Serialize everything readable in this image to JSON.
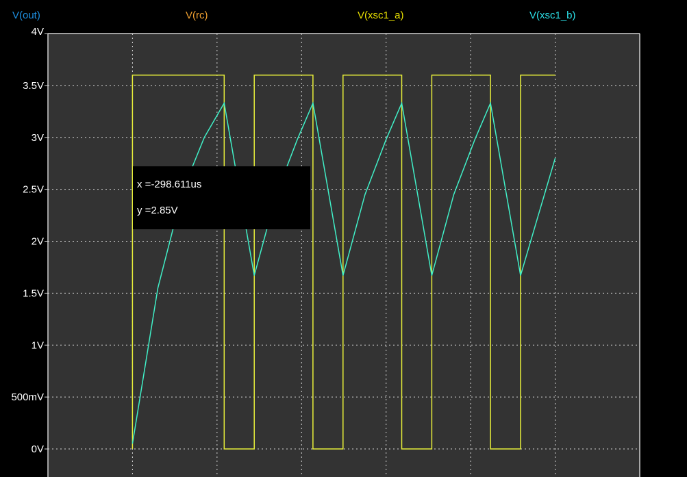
{
  "legend": [
    {
      "name": "V(out)",
      "color": "#1e8fe0"
    },
    {
      "name": "V(rc)",
      "color": "#f0a030"
    },
    {
      "name": "V(xsc1_a)",
      "color": "#e8e000"
    },
    {
      "name": "V(xsc1_b)",
      "color": "#2ce0e8"
    }
  ],
  "colors": {
    "background": "#000000",
    "plot_area": "#333333",
    "grid": "#d8d8d8",
    "axis_text": "#ffffff",
    "square_wave": "#e8ef3a",
    "rc_wave": "#40f0c8"
  },
  "cursor": {
    "x_label": "x = ",
    "x_value": "-298.611us",
    "y_label": "y = ",
    "y_value": "2.85V"
  },
  "chart_data": {
    "type": "line",
    "title": "",
    "xlabel": "",
    "ylabel": "",
    "yticks": [
      {
        "value": 4,
        "label": "4V"
      },
      {
        "value": 3.5,
        "label": "3.5V"
      },
      {
        "value": 3,
        "label": "3V"
      },
      {
        "value": 2.5,
        "label": "2.5V"
      },
      {
        "value": 2,
        "label": "2V"
      },
      {
        "value": 1.5,
        "label": "1.5V"
      },
      {
        "value": 1,
        "label": "1V"
      },
      {
        "value": 0.5,
        "label": "500mV"
      },
      {
        "value": 0,
        "label": "0V"
      }
    ],
    "ylim": [
      -0.27,
      4.0
    ],
    "xlim": [
      0,
      14
    ],
    "x_gridlines": [
      2,
      4,
      6,
      8,
      10,
      12
    ],
    "grid": true,
    "series": [
      {
        "color": "#e8ef3a",
        "x": [
          2,
          2,
          4.17,
          4.17,
          4.88,
          4.88,
          6.27,
          6.27,
          6.98,
          6.98,
          8.37,
          8.37,
          9.08,
          9.08,
          10.47,
          10.47,
          11.18,
          11.18,
          12
        ],
        "y": [
          0,
          3.6,
          3.6,
          0,
          0,
          3.6,
          3.6,
          0,
          0,
          3.6,
          3.6,
          0,
          0,
          3.6,
          3.6,
          0,
          0,
          3.6,
          3.6
        ]
      },
      {
        "color": "#40f0c8",
        "x": [
          2,
          2.6,
          3.2,
          3.7,
          4.17,
          4.88,
          5.4,
          5.9,
          6.27,
          6.98,
          7.5,
          8.0,
          8.37,
          9.08,
          9.6,
          10.1,
          10.47,
          11.18,
          11.6,
          12
        ],
        "y": [
          0.05,
          1.55,
          2.5,
          3.0,
          3.33,
          1.67,
          2.45,
          2.98,
          3.33,
          1.67,
          2.45,
          2.98,
          3.33,
          1.67,
          2.45,
          2.98,
          3.33,
          1.67,
          2.25,
          2.8
        ]
      }
    ]
  }
}
